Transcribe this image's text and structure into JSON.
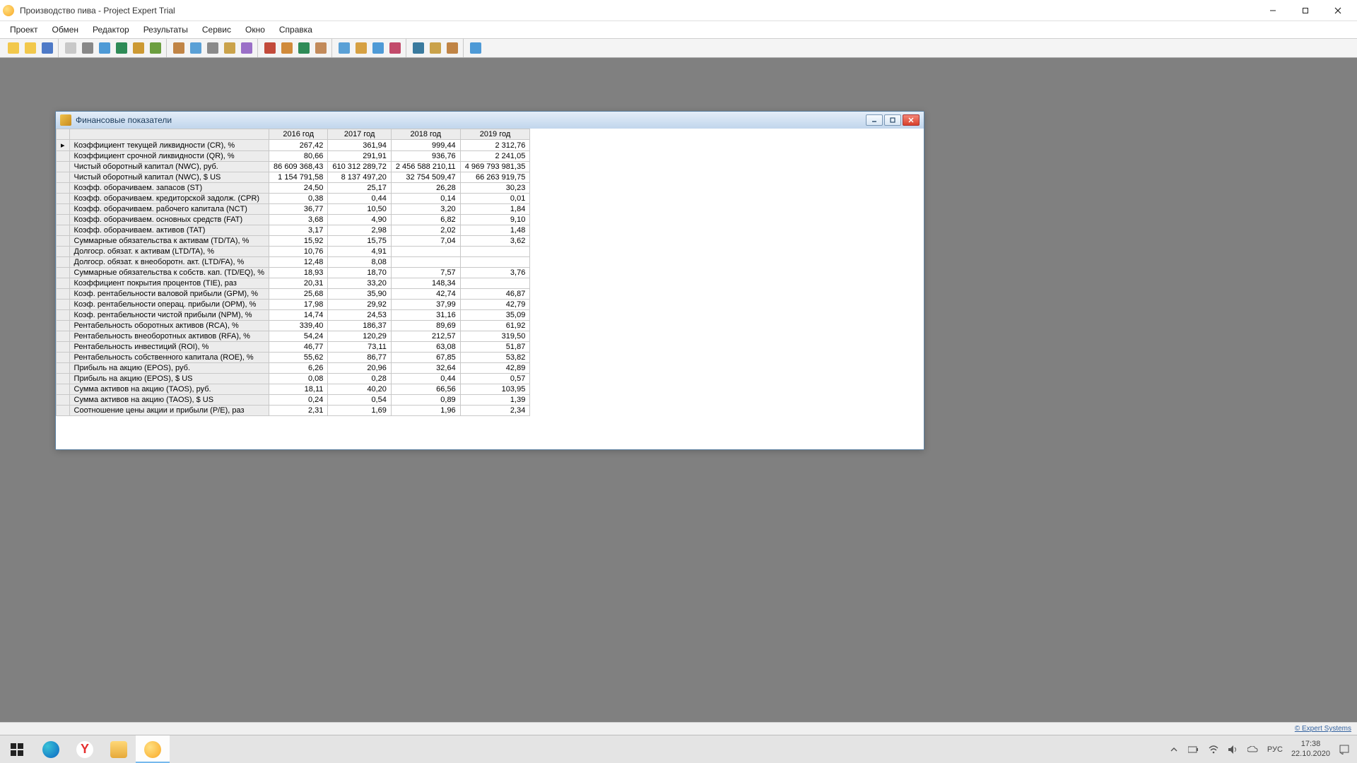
{
  "window_title": "Производство пива - Project Expert Trial",
  "menu": [
    "Проект",
    "Обмен",
    "Редактор",
    "Результаты",
    "Сервис",
    "Окно",
    "Справка"
  ],
  "toolbar_groups": [
    [
      "new-project",
      "open-project",
      "save-project"
    ],
    [
      "preview",
      "print",
      "calendar",
      "html-export",
      "text-export",
      "chart-tool"
    ],
    [
      "form-1",
      "form-2",
      "form-3",
      "form-4",
      "form-5"
    ],
    [
      "report-1",
      "report-2",
      "report-3",
      "report-4"
    ],
    [
      "analysis-1",
      "analysis-2",
      "analysis-3",
      "analysis-4"
    ],
    [
      "result-1",
      "result-2",
      "result-3"
    ],
    [
      "clipboard"
    ]
  ],
  "toolbar_colors": {
    "new-project": "#f2c84b",
    "open-project": "#f2c84b",
    "save-project": "#4e7ac7",
    "preview": "#c8c8c8",
    "print": "#888",
    "calendar": "#4e9ad6",
    "html-export": "#2e8b57",
    "text-export": "#cc9933",
    "chart-tool": "#6b9e3f",
    "form-1": "#c08445",
    "form-2": "#5aa0d6",
    "form-3": "#8a8a8a",
    "form-4": "#caa24a",
    "form-5": "#9a6fc7",
    "report-1": "#c24a3a",
    "report-2": "#d08a3a",
    "report-3": "#2e8b57",
    "report-4": "#c28a5a",
    "analysis-1": "#5aa0d6",
    "analysis-2": "#d6a042",
    "analysis-3": "#4e9ad6",
    "analysis-4": "#c24a6a",
    "result-1": "#3a7a9e",
    "result-2": "#caa24a",
    "result-3": "#c08445",
    "clipboard": "#4e9ad6"
  },
  "child_window": {
    "title": "Финансовые показатели",
    "columns": [
      "2016 год",
      "2017 год",
      "2018 год",
      "2019 год"
    ],
    "rows": [
      {
        "label": "Коэффициент текущей ликвидности (CR), %",
        "v": [
          "267,42",
          "361,94",
          "999,44",
          "2 312,76"
        ],
        "selected": true
      },
      {
        "label": "Коэффициент срочной ликвидности (QR), %",
        "v": [
          "80,66",
          "291,91",
          "936,76",
          "2 241,05"
        ]
      },
      {
        "label": "Чистый оборотный капитал (NWC), руб.",
        "v": [
          "86 609 368,43",
          "610 312 289,72",
          "2 456 588 210,11",
          "4 969 793 981,35"
        ]
      },
      {
        "label": "Чистый оборотный капитал (NWC), $ US",
        "v": [
          "1 154 791,58",
          "8 137 497,20",
          "32 754 509,47",
          "66 263 919,75"
        ]
      },
      {
        "label": "Коэфф. оборачиваем. запасов (ST)",
        "v": [
          "24,50",
          "25,17",
          "26,28",
          "30,23"
        ]
      },
      {
        "label": "Коэфф. оборачиваем. кредиторской задолж. (CPR)",
        "v": [
          "0,38",
          "0,44",
          "0,14",
          "0,01"
        ]
      },
      {
        "label": "Коэфф. оборачиваем. рабочего капитала (NCT)",
        "v": [
          "36,77",
          "10,50",
          "3,20",
          "1,84"
        ]
      },
      {
        "label": "Коэфф. оборачиваем. основных средств (FAT)",
        "v": [
          "3,68",
          "4,90",
          "6,82",
          "9,10"
        ]
      },
      {
        "label": "Коэфф. оборачиваем. активов (TAT)",
        "v": [
          "3,17",
          "2,98",
          "2,02",
          "1,48"
        ]
      },
      {
        "label": "Суммарные обязательства к активам (TD/TA), %",
        "v": [
          "15,92",
          "15,75",
          "7,04",
          "3,62"
        ]
      },
      {
        "label": "Долгоср. обязат. к активам (LTD/TA), %",
        "v": [
          "10,76",
          "4,91",
          "",
          ""
        ]
      },
      {
        "label": "Долгоср. обязат. к внеоборотн. акт. (LTD/FA), %",
        "v": [
          "12,48",
          "8,08",
          "",
          ""
        ]
      },
      {
        "label": "Суммарные обязательства к собств. кап. (TD/EQ), %",
        "v": [
          "18,93",
          "18,70",
          "7,57",
          "3,76"
        ]
      },
      {
        "label": "Коэффициент покрытия процентов (TIE), раз",
        "v": [
          "20,31",
          "33,20",
          "148,34",
          ""
        ]
      },
      {
        "label": "Коэф. рентабельности валовой прибыли (GPM), %",
        "v": [
          "25,68",
          "35,90",
          "42,74",
          "46,87"
        ]
      },
      {
        "label": "Коэф. рентабельности операц. прибыли (OPM), %",
        "v": [
          "17,98",
          "29,92",
          "37,99",
          "42,79"
        ]
      },
      {
        "label": "Коэф. рентабельности чистой прибыли (NPM), %",
        "v": [
          "14,74",
          "24,53",
          "31,16",
          "35,09"
        ]
      },
      {
        "label": "Рентабельность оборотных активов (RCA), %",
        "v": [
          "339,40",
          "186,37",
          "89,69",
          "61,92"
        ]
      },
      {
        "label": "Рентабельность внеоборотных активов (RFA), %",
        "v": [
          "54,24",
          "120,29",
          "212,57",
          "319,50"
        ]
      },
      {
        "label": "Рентабельность инвестиций (ROI), %",
        "v": [
          "46,77",
          "73,11",
          "63,08",
          "51,87"
        ]
      },
      {
        "label": "Рентабельность собственного капитала (ROE), %",
        "v": [
          "55,62",
          "86,77",
          "67,85",
          "53,82"
        ]
      },
      {
        "label": "Прибыль на акцию (EPOS), руб.",
        "v": [
          "6,26",
          "20,96",
          "32,64",
          "42,89"
        ]
      },
      {
        "label": "Прибыль на акцию (EPOS), $ US",
        "v": [
          "0,08",
          "0,28",
          "0,44",
          "0,57"
        ]
      },
      {
        "label": "Сумма активов на акцию (TAOS), руб.",
        "v": [
          "18,11",
          "40,20",
          "66,56",
          "103,95"
        ]
      },
      {
        "label": "Сумма активов на акцию (TAOS), $ US",
        "v": [
          "0,24",
          "0,54",
          "0,89",
          "1,39"
        ]
      },
      {
        "label": "Соотношение цены акции и прибыли (P/E), раз",
        "v": [
          "2,31",
          "1,69",
          "1,96",
          "2,34"
        ]
      }
    ]
  },
  "status_link": "© Expert Systems",
  "tray": {
    "lang": "РУС",
    "time": "17:38",
    "date": "22.10.2020"
  }
}
